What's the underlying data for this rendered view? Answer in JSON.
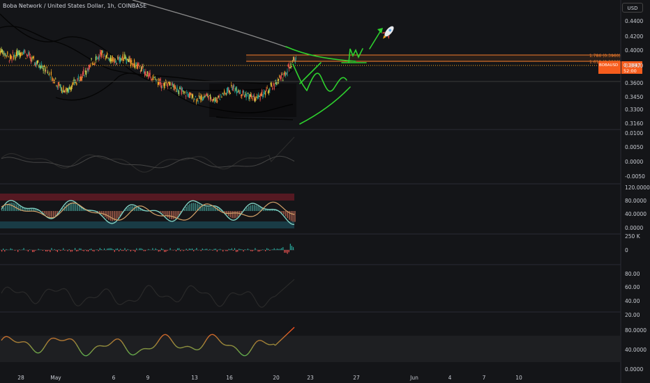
{
  "header": {
    "title": "Boba Network / United States Dollar, 1h, COINBASE",
    "currency": "USD"
  },
  "colors": {
    "background": "#141518",
    "candle_up": "#26a69a",
    "candle_down": "#ef5350",
    "drawing": "#2ed12e",
    "fib": "#f57c2a",
    "price_tag": "#f75d1d",
    "band": "#000000"
  },
  "chart_data": {
    "type": "line",
    "symbol": "BOBAUSD",
    "interval": "1h",
    "price_axis": {
      "ticks": [
        "0.4400",
        "0.4200",
        "0.4000",
        "0.3800",
        "0.3600",
        "0.3450",
        "0.3300",
        "0.3160"
      ],
      "ylim": [
        0.31,
        0.45
      ]
    },
    "x_ticks": [
      "28",
      "May",
      "6",
      "9",
      "13",
      "16",
      "20",
      "23",
      "27",
      "Jun",
      "4",
      "7",
      "10"
    ],
    "fib_levels": [
      {
        "label": "1.786 (0.3960)",
        "value": 0.396
      },
      {
        "label": "1.618 (0.3900)",
        "value": 0.39
      }
    ],
    "last_price": {
      "symbol": "BOBAUSD",
      "value": "0.3847",
      "countdown": "52:00"
    },
    "annotations": [
      "rocket",
      "green arrow",
      "hand-drawn green path"
    ],
    "indicators": [
      {
        "name": "oscillator_1",
        "ticks": [
          "0.0100",
          "0.0050",
          "0.0000",
          "-0.0050"
        ]
      },
      {
        "name": "oscillator_2",
        "ticks": [
          "120.0000",
          "80.0000",
          "40.0000",
          "0.0000"
        ]
      },
      {
        "name": "volume_delta",
        "ticks": [
          "250 K",
          "0"
        ]
      },
      {
        "name": "oscillator_3",
        "ticks": [
          "80.00",
          "60.00",
          "40.00",
          "20.00"
        ]
      },
      {
        "name": "oscillator_4",
        "ticks": [
          "80.0000",
          "40.0000",
          "0.0000"
        ]
      }
    ],
    "price_series": [
      0.405,
      0.4,
      0.395,
      0.398,
      0.402,
      0.404,
      0.399,
      0.393,
      0.388,
      0.385,
      0.38,
      0.372,
      0.365,
      0.358,
      0.352,
      0.35,
      0.356,
      0.362,
      0.368,
      0.375,
      0.382,
      0.39,
      0.396,
      0.401,
      0.398,
      0.394,
      0.39,
      0.393,
      0.396,
      0.392,
      0.388,
      0.385,
      0.38,
      0.375,
      0.37,
      0.366,
      0.362,
      0.358,
      0.36,
      0.357,
      0.353,
      0.35,
      0.346,
      0.344,
      0.341,
      0.339,
      0.341,
      0.343,
      0.34,
      0.338,
      0.342,
      0.346,
      0.35,
      0.354,
      0.351,
      0.347,
      0.344,
      0.342,
      0.339,
      0.342,
      0.346,
      0.35,
      0.356,
      0.362,
      0.368,
      0.375,
      0.384,
      0.392
    ]
  }
}
